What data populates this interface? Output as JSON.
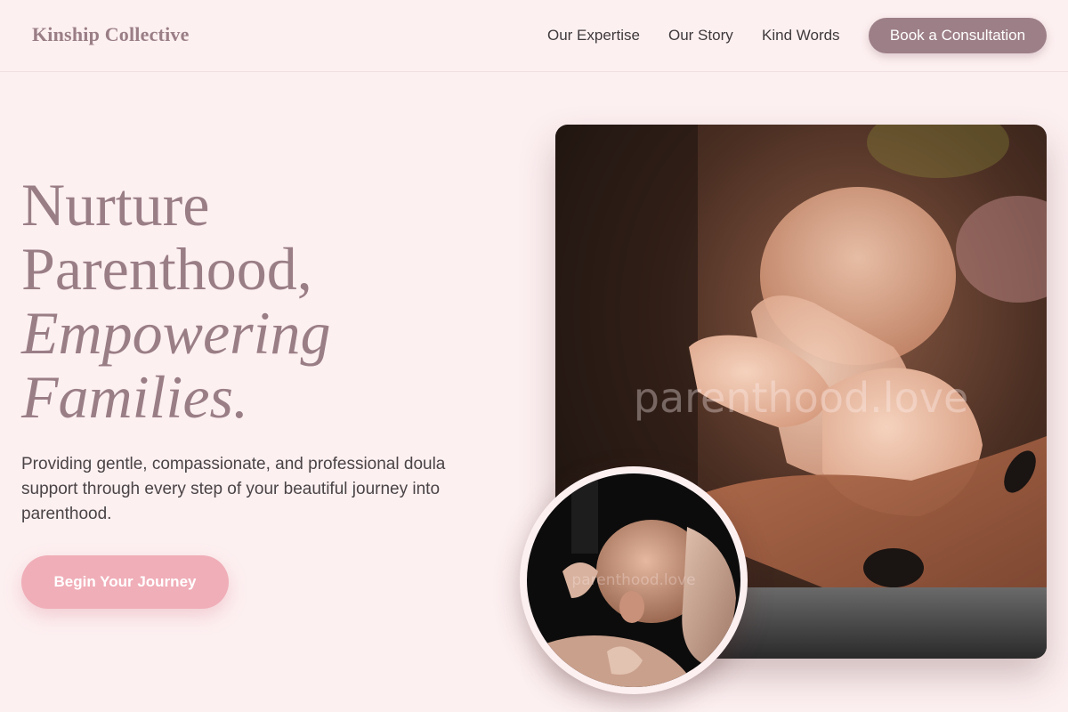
{
  "brand": {
    "name": "Kinship Collective"
  },
  "nav": {
    "links": [
      "Our Expertise",
      "Our Story",
      "Kind Words"
    ],
    "cta_label": "Book a Consultation"
  },
  "hero": {
    "title_lines": [
      "Nurture",
      "Parenthood,",
      "Empowering",
      "Families."
    ],
    "subtitle": "Providing gentle, compassionate, and professional doula support through every step of your beautiful journey into parenthood.",
    "button_label": "Begin Your Journey"
  },
  "images": {
    "main_watermark": "parenthood.love",
    "circle_watermark": "parenthood.love"
  },
  "colors": {
    "background": "#fdf0f1",
    "brand": "#9a7e86",
    "cta": "#9d7f87",
    "primary_button": "#f0aeb8"
  }
}
